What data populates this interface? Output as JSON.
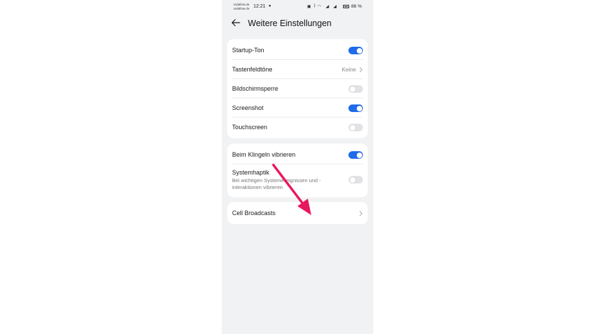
{
  "status_bar": {
    "carrier_1": "vodafone.de",
    "carrier_2": "vodafone.de",
    "time": "12:21",
    "battery": "86 %"
  },
  "header": {
    "title": "Weitere Einstellungen"
  },
  "group_1": [
    {
      "label": "Startup-Ton",
      "control": "toggle",
      "on": true
    },
    {
      "label": "Tastenfeldtöne",
      "control": "chevron",
      "value": "Keine"
    },
    {
      "label": "Bildschirmsperre",
      "control": "toggle",
      "on": false
    },
    {
      "label": "Screenshot",
      "control": "toggle",
      "on": true
    },
    {
      "label": "Touchscreen",
      "control": "toggle",
      "on": false
    }
  ],
  "group_2": [
    {
      "label": "Beim Klingeln vibrieren",
      "control": "toggle",
      "on": true
    },
    {
      "label": "Systemhaptik",
      "sublabel": "Bei wichtigen Systemereignissen und -interaktionen vibrieren",
      "control": "toggle",
      "on": false
    }
  ],
  "group_3": [
    {
      "label": "Cell Broadcasts",
      "control": "chevron"
    }
  ],
  "colors": {
    "toggle_on": "#1f6bea",
    "toggle_off": "#e1e2e5",
    "annotation_arrow": "#e8175d",
    "background": "#f1f2f4"
  }
}
